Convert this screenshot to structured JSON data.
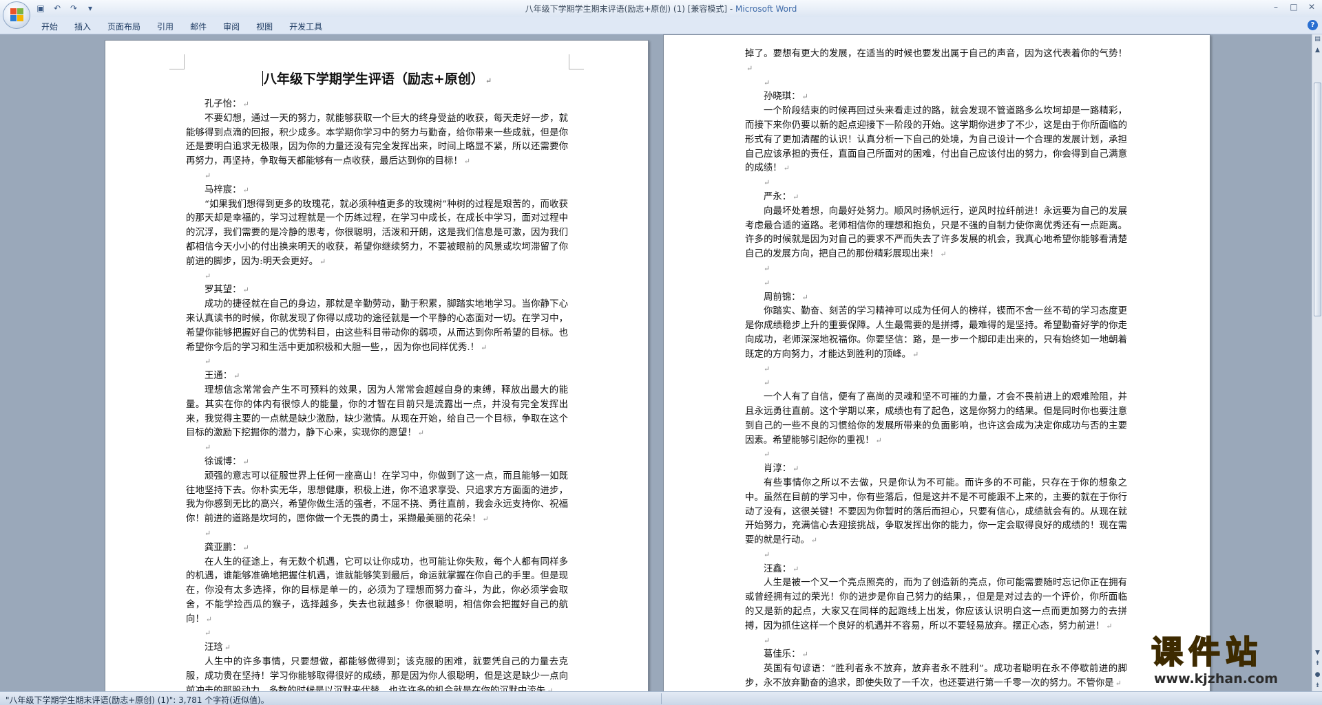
{
  "window": {
    "title_prefix": "八年级下学期学生期末评语(励志+原创) (1) [兼容模式] - ",
    "app_name": "Microsoft Word",
    "controls": [
      "–",
      "□",
      "✕"
    ]
  },
  "qat": {
    "icons": [
      "save-icon",
      "undo-icon",
      "redo-icon",
      "customize-icon"
    ],
    "glyphs": [
      "▣",
      "↶",
      "↷",
      "▾"
    ]
  },
  "ribbon": {
    "tabs": [
      "开始",
      "插入",
      "页面布局",
      "引用",
      "邮件",
      "审阅",
      "视图",
      "开发工具"
    ],
    "help": "?"
  },
  "colors": {
    "accent": "#3e6aa8",
    "watermark": "#f5d20a"
  },
  "document": {
    "title": "八年级下学期学生评语（励志+原创）",
    "mark": "↵",
    "left_page": [
      {
        "t": "name",
        "text": "孔子怡："
      },
      {
        "t": "para",
        "text": "不要幻想，通过一天的努力，就能够获取一个巨大的终身受益的收获，每天走好一步，就能够得到点滴的回报，积少成多。本学期你学习中的努力与勤奋，给你带来一些成就，但是你还是要明白追求无极限，因为你的力量还没有完全发挥出来，时间上略显不紧，所以还需要你再努力，再坚持，争取每天都能够有一点收获，最后达到你的目标！"
      },
      {
        "t": "empty"
      },
      {
        "t": "name",
        "text": "马梓宸："
      },
      {
        "t": "para",
        "text": "“如果我们想得到更多的玫瑰花，就必须种植更多的玫瑰树”种树的过程是艰苦的，而收获的那天却是幸福的，学习过程就是一个历练过程，在学习中成长，在成长中学习，面对过程中的沉浮，我们需要的是冷静的思考，你很聪明，活泼和开朗，这是我们信息是可激，因为我们都相信今天小小的付出换来明天的收获，希望你继续努力，不要被眼前的风景或坎坷滞留了你前进的脚步，因为:明天会更好。"
      },
      {
        "t": "empty"
      },
      {
        "t": "name",
        "text": "罗其望："
      },
      {
        "t": "para",
        "text": "成功的捷径就在自己的身边，那就是辛勤劳动，勤于积累，脚踏实地地学习。当你静下心来认真读书的时候，你就发现了你得以成功的途径就是一个平静的心态面对一切。在学习中，希望你能够把握好自己的优势科目，由这些科目带动你的弱项，从而达到你所希望的目标。也希望你今后的学习和生活中更加积极和大胆一些，，因为你也同样优秀.！"
      },
      {
        "t": "empty"
      },
      {
        "t": "name",
        "text": "王通："
      },
      {
        "t": "para",
        "text": "理想信念常常会产生不可预料的效果，因为人常常会超越自身的束缚，释放出最大的能量。其实在你的体内有很惊人的能量，你的才智在目前只是流露出一点，并没有完全发挥出来，我觉得主要的一点就是缺少激励，缺少激情。从现在开始，给自己一个目标，争取在这个目标的激励下挖掘你的潜力，静下心来，实现你的愿望！"
      },
      {
        "t": "empty"
      },
      {
        "t": "name",
        "text": "徐诚博："
      },
      {
        "t": "para",
        "text": "顽强的意志可以征服世界上任何一座高山！在学习中，你做到了这一点，而且能够一如既往地坚持下去。你朴实无华，思想健康，积极上进，你不追求享受、只追求方方面面的进步，我为你感到无比的高兴，希望你做生活的强者，不屈不挠、勇往直前，我会永远支持你、祝福你！前进的道路是坎坷的，愿你做一个无畏的勇士，采撷最美丽的花朵！"
      },
      {
        "t": "empty"
      },
      {
        "t": "name",
        "text": "龚亚鹏："
      },
      {
        "t": "para",
        "text": "在人生的征途上，有无数个机遇，它可以让你成功，也可能让你失败，每个人都有同样多的机遇，谁能够准确地把握住机遇，谁就能够笑到最后，命运就掌握在你自己的手里。但是现在，你没有太多选择，你的目标是单一的，必须为了理想而努力奋斗，为此，你必须学会取舍，不能学捡西瓜的猴子，选择越多，失去也就越多！你很聪明，相信你会把握好自己的航向！"
      },
      {
        "t": "empty"
      },
      {
        "t": "name",
        "text": "汪琀"
      },
      {
        "t": "para",
        "text": "人生中的许多事情，只要想做，都能够做得到；该克服的困难，就要凭自己的力量去克服，成功贵在坚持！学习你能够取得很好的成绩，那是因为你人很聪明，但是这是缺少一点向前冲击的那股动力，多数的时候是以沉默来代替，也许许多的机会就是在你的沉默中流失"
      }
    ],
    "right_page": [
      {
        "t": "cont",
        "text": "掉了。要想有更大的发展，在适当的时候也要发出属于自己的声音，因为这代表着你的气势！"
      },
      {
        "t": "empty"
      },
      {
        "t": "name",
        "text": "孙晓琪："
      },
      {
        "t": "para",
        "text": "一个阶段结束的时候再回过头来看走过的路，就会发现不管道路多么坎坷却是一路精彩，而接下来你仍要以新的起点迎接下一阶段的开始。这学期你进步了不少，这是由于你所面临的形式有了更加清醒的认识！认真分析一下自己的处境，为自己设计一个合理的发展计划，承担自己应该承担的责任，直面自己所面对的困难，付出自己应该付出的努力，你会得到自己满意的成绩！"
      },
      {
        "t": "empty"
      },
      {
        "t": "name",
        "text": "严永："
      },
      {
        "t": "para",
        "text": "向最坏处着想，向最好处努力。顺风时扬帆远行，逆风时拉纤前进！永远要为自己的发展考虑最合适的道路。老师相信你的理想和抱负，只是不强的自制力使你离优秀还有一点距离。许多的时候就是因为对自己的要求不严而失去了许多发展的机会，我真心地希望你能够看清楚自己的发展方向，把自己的那份精彩展现出来！"
      },
      {
        "t": "empty"
      },
      {
        "t": "empty"
      },
      {
        "t": "name",
        "text": "周前锦："
      },
      {
        "t": "para",
        "text": "你踏实、勤奋、刻苦的学习精神可以成为任何人的榜样，锲而不舍一丝不苟的学习态度更是你成绩稳步上升的重要保障。人生最需要的是拼搏，最难得的是坚持。希望勤奋好学的你走向成功，老师深深地祝福你。你要坚信：路，是一步一个脚印走出来的，只有始终如一地朝着既定的方向努力，才能达到胜利的顶峰。"
      },
      {
        "t": "empty"
      },
      {
        "t": "empty"
      },
      {
        "t": "para",
        "text": "一个人有了自信，便有了高尚的灵魂和坚不可摧的力量，才会不畏前进上的艰难险阻，并且永远勇往直前。这个学期以来，成绩也有了起色，这是你努力的结果。但是同时你也要注意到自己的一些不良的习惯给你的发展所带来的负面影响，也许这会成为决定你成功与否的主要因素。希望能够引起你的重视！"
      },
      {
        "t": "empty"
      },
      {
        "t": "name",
        "text": "肖淳："
      },
      {
        "t": "para",
        "text": "有些事情你之所以不去做，只是你认为不可能。而许多的不可能，只存在于你的想象之中。虽然在目前的学习中，你有些落后，但是这并不是不可能跟不上来的，主要的就在于你行动了没有，这很关键！不要因为你暂时的落后而担心，只要有信心，成绩就会有的。从现在就开始努力，充满信心去迎接挑战，争取发挥出你的能力，你一定会取得良好的成绩的！现在需要的就是行动。"
      },
      {
        "t": "empty"
      },
      {
        "t": "name",
        "text": "汪鑫："
      },
      {
        "t": "para",
        "text": "人生是被一个又一个亮点照亮的，而为了创造新的亮点，你可能需要随时忘记你正在拥有或曾经拥有过的荣光！你的进步是你自己努力的结果，，但是是对过去的一个评价，你所面临的又是新的起点，大家又在同样的起跑线上出发，你应该认识明白这一点而更加努力的去拼搏，因为抓住这样一个良好的机遇并不容易，所以不要轻易放弃。摆正心态，努力前进！"
      },
      {
        "t": "empty"
      },
      {
        "t": "name",
        "text": "葛佳乐："
      },
      {
        "t": "para",
        "text": "英国有句谚语：“胜利者永不放弃，放弃者永不胜利”。成功者聪明在永不停歇前进的脚步，永不放弃勤奋的追求，即使失败了一千次，也还要进行第一千零一次的努力。不管你是"
      }
    ]
  },
  "statusbar": {
    "text": "\"八年级下学期学生期末评语(励志+原创) (1)\": 3,781 个字符(近似值)。"
  },
  "watermark": {
    "title": "课件站",
    "url": "www.kjzhan.com"
  }
}
